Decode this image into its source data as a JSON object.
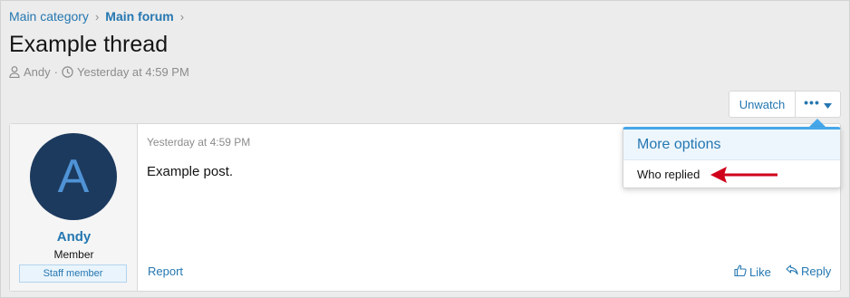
{
  "breadcrumb": {
    "items": [
      "Main category",
      "Main forum"
    ]
  },
  "thread": {
    "title": "Example thread",
    "author": "Andy",
    "separator": "·",
    "date": "Yesterday at 4:59 PM"
  },
  "toolbar": {
    "unwatch_label": "Unwatch",
    "more_label": "•••"
  },
  "menu": {
    "header": "More options",
    "items": [
      "Who replied"
    ]
  },
  "post": {
    "user": {
      "avatar_letter": "A",
      "name": "Andy",
      "title": "Member",
      "banner": "Staff member"
    },
    "date": "Yesterday at 4:59 PM",
    "body": "Example post.",
    "actions": {
      "report": "Report",
      "like": "Like",
      "reply": "Reply"
    }
  },
  "colors": {
    "link": "#2577b1",
    "avatar_bg": "#1c3a5e",
    "menu_accent": "#47a7eb",
    "annotation_arrow": "#d0021b"
  },
  "icons": [
    "user-icon",
    "clock-icon",
    "chevron-right-icon",
    "caret-down-icon",
    "thumbs-up-icon",
    "reply-icon"
  ]
}
